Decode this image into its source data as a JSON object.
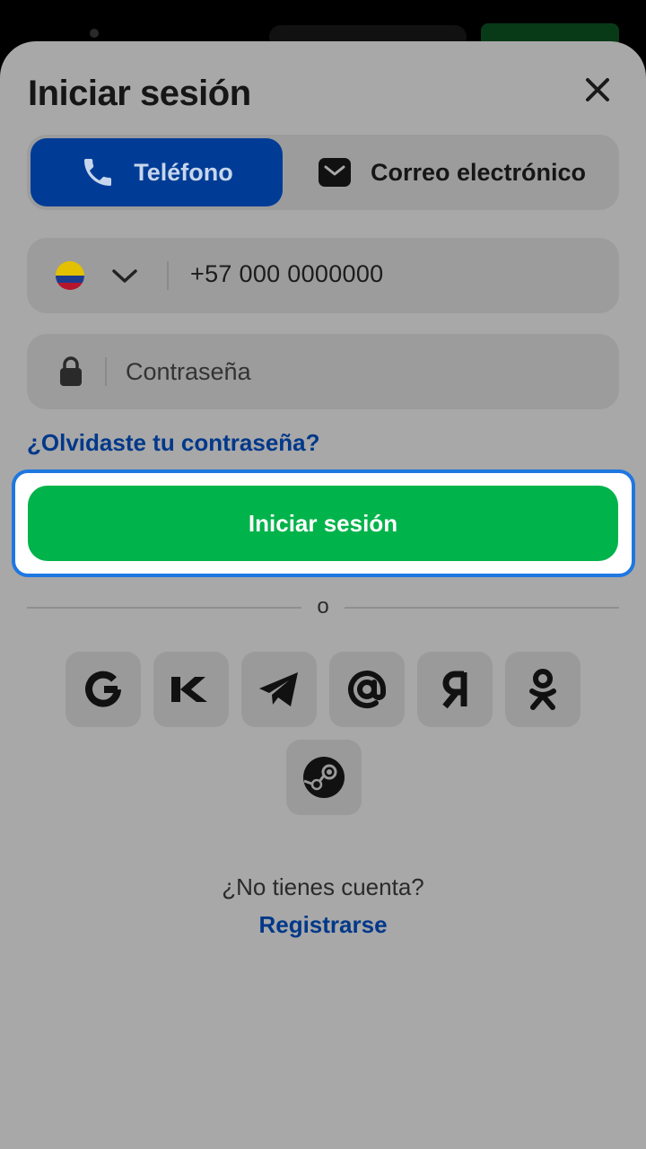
{
  "header": {
    "title": "Iniciar sesión"
  },
  "tabs": [
    {
      "label": "Teléfono",
      "icon": "phone-icon",
      "active": true
    },
    {
      "label": "Correo electrónico",
      "icon": "mail-icon",
      "active": false
    }
  ],
  "phone_field": {
    "value": "+57 000 0000000",
    "country_icon": "colombia-flag-icon"
  },
  "password_field": {
    "placeholder": "Contraseña"
  },
  "forgot_password": "¿Olvidaste tu contraseña?",
  "submit_label": "Iniciar sesión",
  "divider_text": "o",
  "social_providers": [
    "google-icon",
    "vk-icon",
    "telegram-icon",
    "mail-ru-icon",
    "yandex-icon",
    "odnoklassniki-icon",
    "steam-icon"
  ],
  "footer": {
    "no_account": "¿No tienes cuenta?",
    "register": "Registrarse"
  },
  "colors": {
    "primary_blue": "#003c96",
    "link_blue": "#00388a",
    "green": "#00b34a",
    "focus_ring": "#1f77e0"
  }
}
